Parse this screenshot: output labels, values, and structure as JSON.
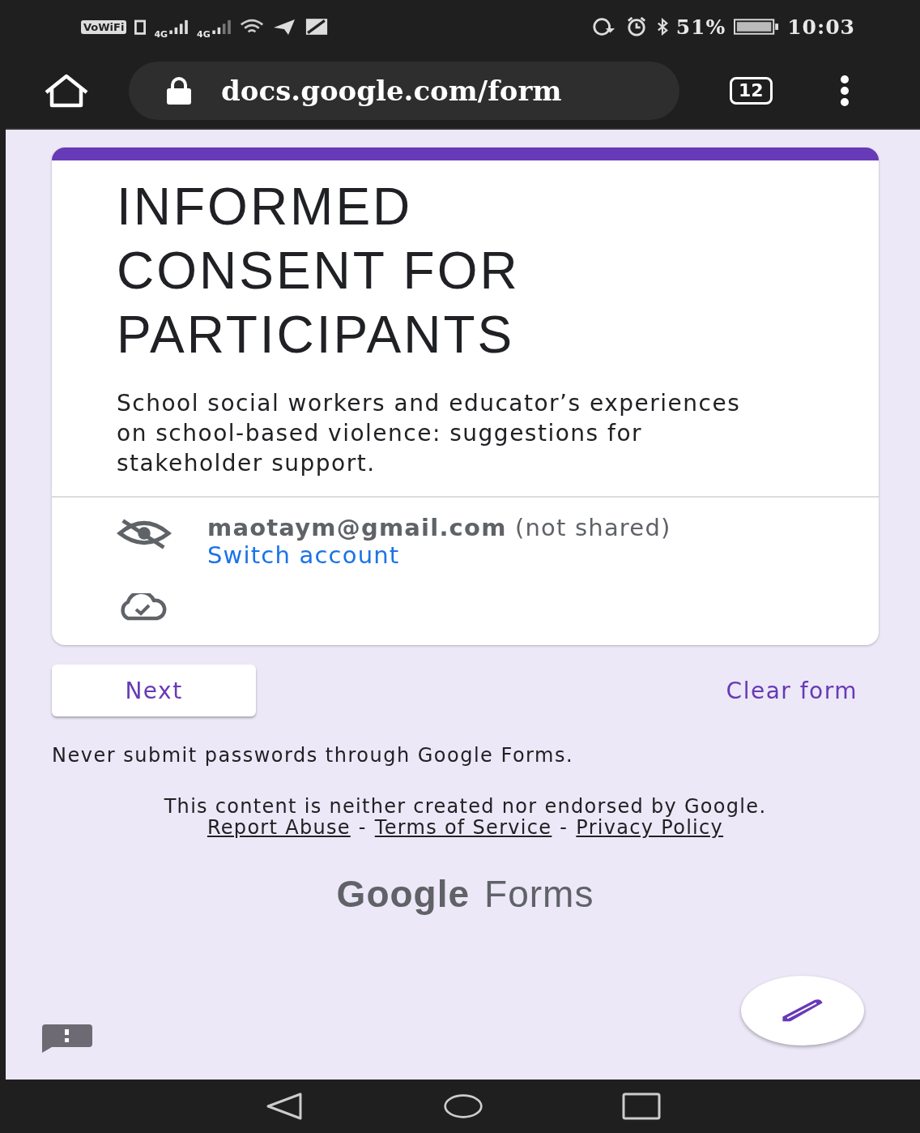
{
  "status_bar": {
    "wifi_calling": "VoWiFi",
    "sim_badges": [
      "4G",
      "4G"
    ],
    "battery": "51%",
    "time": "10:03"
  },
  "browser": {
    "url": "docs.google.com/form",
    "tab_count": "12"
  },
  "form": {
    "title": "INFORMED CONSENT FOR PARTICIPANTS",
    "description": "School social workers and educator’s experiences on school-based violence: suggestions for stakeholder support.",
    "account": {
      "email": "maotaym@gmail.com",
      "note": "(not shared)",
      "switch_link": "Switch account"
    }
  },
  "actions": {
    "next": "Next",
    "clear": "Clear form"
  },
  "footer": {
    "warning": "Never submit passwords through Google Forms.",
    "disclaimer": "This content is neither created nor endorsed by Google.",
    "separator": "-",
    "links": [
      "Report Abuse",
      "Terms of Service",
      "Privacy Policy"
    ]
  },
  "logo": {
    "brand": "Google",
    "product": "Forms"
  }
}
